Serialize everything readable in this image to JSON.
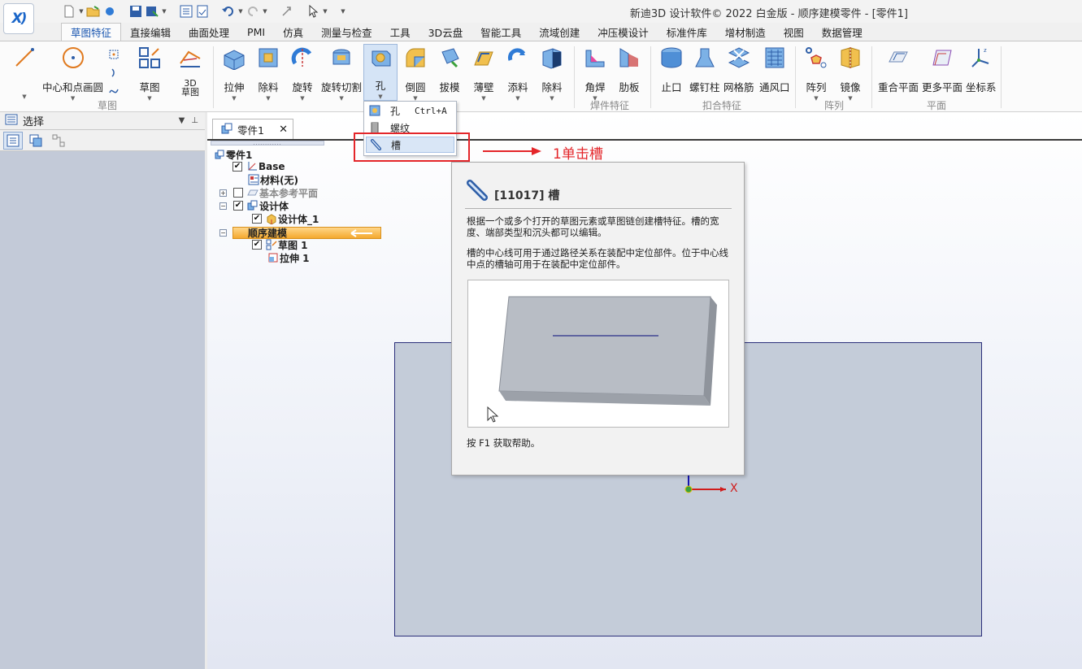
{
  "window": {
    "title": "新迪3D 设计软件© 2022 白金版 - 顺序建模零件 - [零件1]"
  },
  "quick_access": [
    "new-icon",
    "open-icon",
    "save-icon",
    "save-as-icon",
    "undo-icon",
    "redo-icon",
    "select-arrow-icon"
  ],
  "ribbon_tabs": [
    "草图特征",
    "直接编辑",
    "曲面处理",
    "PMI",
    "仿真",
    "测量与检查",
    "工具",
    "3D云盘",
    "智能工具",
    "流域创建",
    "冲压模设计",
    "标准件库",
    "增材制造",
    "视图",
    "数据管理"
  ],
  "ribbon": {
    "sketch": {
      "circle_label": "中心和点画圆",
      "sketch_label": "草图",
      "sketch3d_label": "3D\n草图",
      "group": "草图"
    },
    "features": {
      "extrude": "拉伸",
      "cut": "除料",
      "revolve": "旋转",
      "revolve_cut": "旋转切割",
      "hole": "孔",
      "round": "倒圆",
      "draft": "拔模",
      "thin_wall": "薄壁",
      "add": "添料",
      "remove": "除料"
    },
    "weld": {
      "fillet_weld": "角焊",
      "rib": "肋板",
      "group": "焊件特征"
    },
    "snap": {
      "lip": "止口",
      "boss": "螺钉柱",
      "grid_rib": "网格筋",
      "vent": "通风口",
      "group": "扣合特征"
    },
    "pattern": {
      "pattern": "阵列",
      "mirror": "镜像",
      "group": "阵列"
    },
    "planes": {
      "coincident": "重合平面",
      "more": "更多平面",
      "csys": "坐标系",
      "group": "平面"
    }
  },
  "left_panel": {
    "title": "选择"
  },
  "doc_tab": {
    "label": "零件1"
  },
  "tree": [
    {
      "label": "零件1"
    },
    {
      "label": "Base"
    },
    {
      "label": "材料(无)"
    },
    {
      "label": "基本参考平面"
    },
    {
      "label": "设计体"
    },
    {
      "label": "设计体_1"
    },
    {
      "label": "顺序建模"
    },
    {
      "label": "草图 1"
    },
    {
      "label": "拉伸 1"
    }
  ],
  "dropdown": {
    "items": [
      {
        "label": "孔",
        "shortcut": "Ctrl+A"
      },
      {
        "label": "螺纹",
        "shortcut": ""
      },
      {
        "label": "槽",
        "shortcut": ""
      }
    ]
  },
  "annotation": {
    "text": "1单击槽"
  },
  "tooltip": {
    "title": "[11017] 槽",
    "para1": "根据一个或多个打开的草图元素或草图链创建槽特征。槽的宽度、端部类型和沉头都可以编辑。",
    "para2": "槽的中心线可用于通过路径关系在装配中定位部件。位于中心线中点的槽轴可用于在装配中定位部件。",
    "help": "按 F1 获取帮助。"
  },
  "axis": {
    "x_label": "X"
  },
  "colors": {
    "accent": "#1a56b0",
    "annotation": "#e4262a",
    "highlight": "#f4a92e"
  }
}
